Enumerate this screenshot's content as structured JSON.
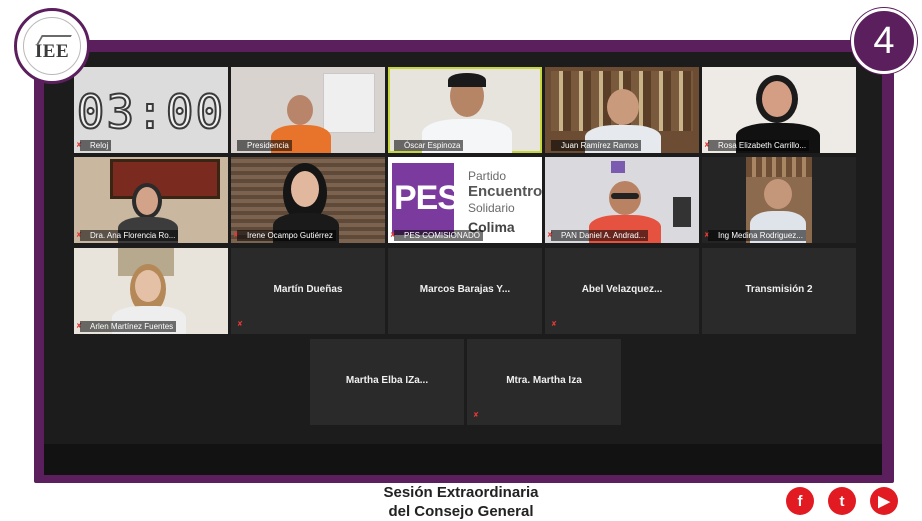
{
  "logo": {
    "text": "IEE"
  },
  "channel": {
    "number": "4"
  },
  "clock": {
    "time": "03:00"
  },
  "tiles": [
    {
      "name": "Reloj"
    },
    {
      "name": "Presidencia"
    },
    {
      "name": "Óscar Espinoza"
    },
    {
      "name": "Juan Ramírez Ramos"
    },
    {
      "name": "Rosa Elizabeth Carrillo..."
    },
    {
      "name": "Dra. Ana Florencia Ro..."
    },
    {
      "name": "Irene Ocampo Gutiérrez"
    },
    {
      "name": "PES COMISIONADO"
    },
    {
      "name": "PAN Daniel A. Andrad..."
    },
    {
      "name": "Ing Medina Rodriguez..."
    },
    {
      "name": "Arlen Martínez Fuentes"
    },
    {
      "name": "Martín Dueñas"
    },
    {
      "name": "Marcos Barajas Y..."
    },
    {
      "name": "Abel Velazquez..."
    },
    {
      "name": "Transmisión 2"
    },
    {
      "name": "Martha Elba IZa..."
    },
    {
      "name": "Mtra. Martha Iza"
    }
  ],
  "pes": {
    "word": "PES",
    "line1": "Partido",
    "line2": "Encuentro",
    "line3": "Solidario",
    "line4": "Colima"
  },
  "caption": {
    "line1": "Sesión Extraordinaria",
    "line2": "del Consejo General"
  },
  "social": [
    "facebook-icon",
    "twitter-icon",
    "youtube-icon"
  ],
  "colors": {
    "frame": "#5b1f5d",
    "accent": "#e21b23",
    "pes": "#7b3a9e",
    "active_outline": "#c7d63a"
  }
}
